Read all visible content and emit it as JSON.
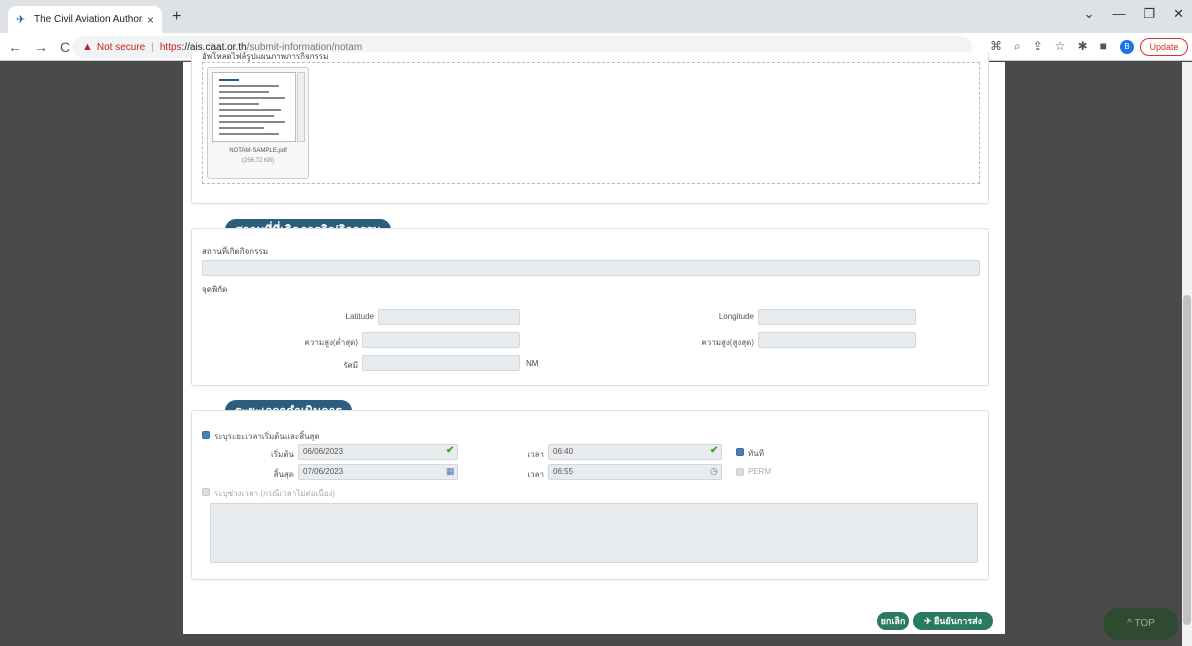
{
  "browser": {
    "tab_title": "The Civil Aviation Authority of Th",
    "tab_close": "×",
    "new_tab": "+",
    "win_min": "—",
    "win_max": "❐",
    "win_close": "✕",
    "win_menu": "⌄",
    "nav_back": "←",
    "nav_forward": "→",
    "nav_reload": "C",
    "not_secure": "Not secure",
    "url_scheme": "https",
    "url_domain": "://ais.caat.or.th",
    "url_path": "/submit-information/notam",
    "update_label": "Update",
    "avatar_letter": "B"
  },
  "upload": {
    "label": "อัพโหลดไฟล์รูปแผนภาพภารกิจกรรม",
    "file_name": "NOTAM-SAMPLE.pdf",
    "file_size": "(256.72 KB)"
  },
  "location": {
    "section_title": "สถานที่ที่เกิดภารกิจ/กิจกรรม",
    "place_label": "สถานที่เกิดกิจกรรม",
    "coords_label": "จุดพิกัด",
    "latitude_label": "Latitude",
    "longitude_label": "Longitude",
    "alt_low_label": "ความสูง(ต่ำสุด)",
    "alt_high_label": "ความสูง(สูงสุด)",
    "radius_label": "รัศมี",
    "radius_unit": "NM"
  },
  "time": {
    "section_title": "ระยะเวลาดำเนินการ",
    "opt1_label": "ระบุระยะเวลาเริ่มต้นและสิ้นสุด",
    "start_label": "เริ่มต้น",
    "start_date": "06/06/2023",
    "end_label": "สิ้นสุด",
    "end_date": "07/06/2023",
    "time_label": "เวลา",
    "start_time": "06:40",
    "end_time": "06:55",
    "now_label": "ทันที",
    "perm_label": "PERM",
    "opt2_label": "ระบุช่วงเวลา (กรณีเวลาไม่ต่อเนื่อง)"
  },
  "actions": {
    "cancel_label": "ยกเลิก",
    "confirm_label": "ยืนยันการส่ง",
    "top_label": "^ TOP"
  }
}
